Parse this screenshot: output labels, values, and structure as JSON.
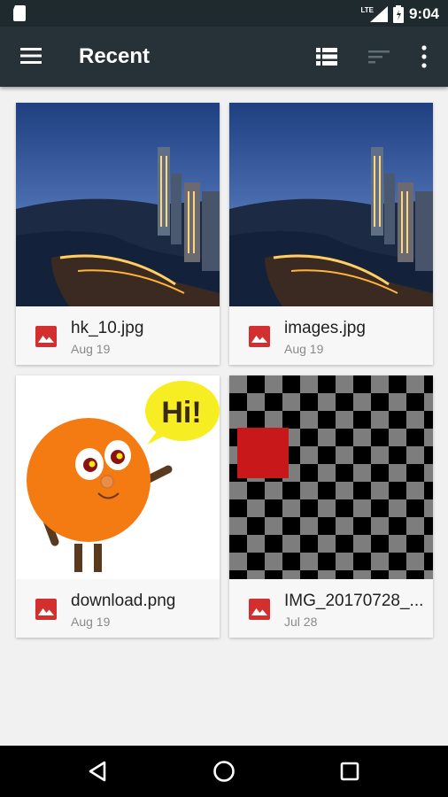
{
  "status": {
    "time": "9:04",
    "network": "LTE"
  },
  "toolbar": {
    "title": "Recent"
  },
  "files": [
    {
      "name": "hk_10.jpg",
      "date": "Aug 19",
      "icon": "image-file-icon"
    },
    {
      "name": "images.jpg",
      "date": "Aug 19",
      "icon": "image-file-icon"
    },
    {
      "name": "download.png",
      "date": "Aug 19",
      "icon": "image-file-icon"
    },
    {
      "name": "IMG_20170728_...",
      "date": "Jul 28",
      "icon": "image-file-icon"
    }
  ],
  "thumb_text": {
    "speech": "Hi!"
  },
  "colors": {
    "toolbar": "#263238",
    "statusbar": "#1f2a2f",
    "file_icon": "#d32f2f",
    "background": "#f1f1f1"
  }
}
